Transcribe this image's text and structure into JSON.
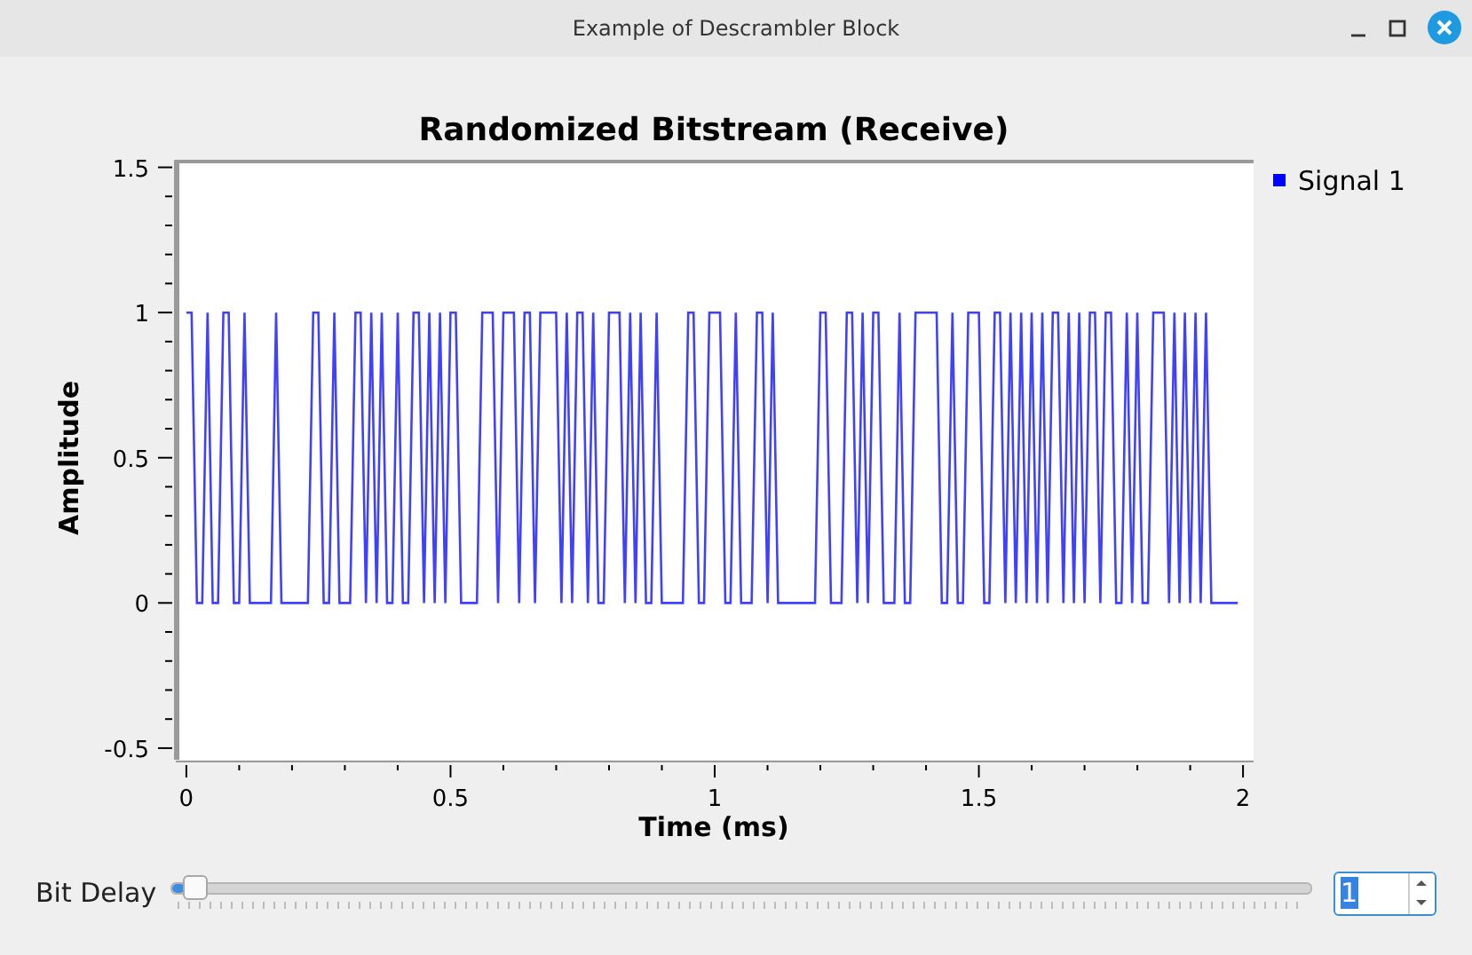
{
  "window": {
    "title": "Example of Descrambler Block"
  },
  "plot": {
    "chart_data": {
      "type": "line",
      "title": "Randomized Bitstream (Receive)",
      "xlabel": "Time (ms)",
      "ylabel": "Amplitude",
      "xlim": [
        -0.02,
        2.02
      ],
      "ylim": [
        -0.54,
        1.52
      ],
      "x": [
        0,
        0.01,
        0.02,
        0.03,
        0.04,
        0.05,
        0.06,
        0.07,
        0.08,
        0.09,
        0.1,
        0.11,
        0.12,
        0.13,
        0.14,
        0.15,
        0.16,
        0.17,
        0.18,
        0.19,
        0.2,
        0.21,
        0.22,
        0.23,
        0.24,
        0.25,
        0.26,
        0.27,
        0.28,
        0.29,
        0.3,
        0.31,
        0.32,
        0.33,
        0.34,
        0.35,
        0.36,
        0.37,
        0.38,
        0.39,
        0.4,
        0.41,
        0.42,
        0.43,
        0.44,
        0.45,
        0.46,
        0.47,
        0.48,
        0.49,
        0.5,
        0.51,
        0.52,
        0.53,
        0.54,
        0.55,
        0.56,
        0.57,
        0.58,
        0.59,
        0.6,
        0.61,
        0.62,
        0.63,
        0.64,
        0.65,
        0.66,
        0.67,
        0.68,
        0.69,
        0.7,
        0.71,
        0.72,
        0.73,
        0.74,
        0.75,
        0.76,
        0.77,
        0.78,
        0.79,
        0.8,
        0.81,
        0.82,
        0.83,
        0.84,
        0.85,
        0.86,
        0.87,
        0.88,
        0.89,
        0.9,
        0.91,
        0.92,
        0.93,
        0.94,
        0.95,
        0.96,
        0.97,
        0.98,
        0.99,
        1,
        1.01,
        1.02,
        1.03,
        1.04,
        1.05,
        1.06,
        1.07,
        1.08,
        1.09,
        1.1,
        1.11,
        1.12,
        1.13,
        1.14,
        1.15,
        1.16,
        1.17,
        1.18,
        1.19,
        1.2,
        1.21,
        1.22,
        1.23,
        1.24,
        1.25,
        1.26,
        1.27,
        1.28,
        1.29,
        1.3,
        1.31,
        1.32,
        1.33,
        1.34,
        1.35,
        1.36,
        1.37,
        1.38,
        1.39,
        1.4,
        1.41,
        1.42,
        1.43,
        1.44,
        1.45,
        1.46,
        1.47,
        1.48,
        1.49,
        1.5,
        1.51,
        1.52,
        1.53,
        1.54,
        1.55,
        1.56,
        1.57,
        1.58,
        1.59,
        1.6,
        1.61,
        1.62,
        1.63,
        1.64,
        1.65,
        1.66,
        1.67,
        1.68,
        1.69,
        1.7,
        1.71,
        1.72,
        1.73,
        1.74,
        1.75,
        1.76,
        1.77,
        1.78,
        1.79,
        1.8,
        1.81,
        1.82,
        1.83,
        1.84,
        1.85,
        1.86,
        1.87,
        1.88,
        1.89,
        1.9,
        1.91,
        1.92,
        1.93,
        1.94,
        1.95,
        1.96,
        1.97,
        1.98,
        1.99
      ],
      "xticks": [
        {
          "value": 0,
          "label": "0"
        },
        {
          "value": 0.5,
          "label": "0.5"
        },
        {
          "value": 1,
          "label": "1"
        },
        {
          "value": 1.5,
          "label": "1.5"
        },
        {
          "value": 2,
          "label": "2"
        }
      ],
      "yticks": [
        {
          "value": -0.5,
          "label": "-0.5"
        },
        {
          "value": 0,
          "label": "0"
        },
        {
          "value": 0.5,
          "label": "0.5"
        },
        {
          "value": 1,
          "label": "1"
        },
        {
          "value": 1.5,
          "label": "1.5"
        }
      ],
      "series": [
        {
          "name": "Signal 1",
          "color": "#0000ff",
          "values": [
            1,
            1,
            0,
            0,
            1,
            0,
            0,
            1,
            1,
            0,
            0,
            1,
            0,
            0,
            0,
            0,
            0,
            1,
            0,
            0,
            0,
            0,
            0,
            0,
            1,
            1,
            0,
            0,
            1,
            0,
            0,
            0,
            1,
            1,
            0,
            1,
            0,
            1,
            0,
            0,
            1,
            0,
            0,
            1,
            1,
            0,
            1,
            0,
            1,
            0,
            1,
            1,
            0,
            0,
            0,
            0,
            1,
            1,
            1,
            0,
            1,
            1,
            1,
            0,
            1,
            1,
            0,
            1,
            1,
            1,
            1,
            0,
            1,
            0,
            1,
            1,
            0,
            1,
            0,
            0,
            1,
            1,
            1,
            0,
            1,
            0,
            1,
            0,
            0,
            1,
            0,
            0,
            0,
            0,
            0,
            1,
            1,
            0,
            0,
            1,
            1,
            1,
            0,
            0,
            1,
            0,
            0,
            0,
            1,
            1,
            0,
            1,
            0,
            0,
            0,
            0,
            0,
            0,
            0,
            0,
            1,
            1,
            0,
            0,
            0,
            1,
            1,
            0,
            1,
            0,
            1,
            1,
            0,
            0,
            0,
            1,
            0,
            0,
            1,
            1,
            1,
            1,
            1,
            0,
            0,
            1,
            0,
            0,
            1,
            1,
            1,
            0,
            0,
            1,
            1,
            0,
            1,
            0,
            1,
            0,
            1,
            0,
            1,
            0,
            1,
            1,
            0,
            1,
            0,
            1,
            0,
            1,
            1,
            0,
            1,
            1,
            0,
            0,
            1,
            0,
            1,
            0,
            0,
            1,
            1,
            1,
            0,
            1,
            0,
            1,
            0,
            1,
            0,
            1,
            0,
            0,
            0,
            0,
            0,
            0
          ]
        }
      ]
    }
  },
  "slider": {
    "label": "Bit Delay",
    "level": 0.01
  },
  "spinbox": {
    "value": "1"
  }
}
